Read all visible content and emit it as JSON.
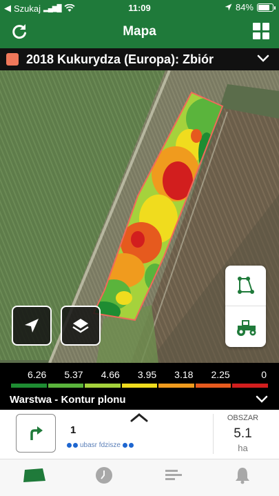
{
  "status_bar": {
    "back_app": "Szukaj",
    "time": "11:09",
    "battery": "84%",
    "battery_level": 0.84
  },
  "navbar": {
    "title": "Mapa",
    "refresh_icon": "refresh-icon",
    "menu_icon": "grid-menu-icon"
  },
  "field_header": {
    "name": "2018 Kukurydza (Europa): Zbiór",
    "swatch_color": "#f0785a"
  },
  "map_controls": {
    "locate_icon": "location-arrow-icon",
    "layers_icon": "layers-icon",
    "field_edit_icon": "field-boundary-icon",
    "tractor_icon": "tractor-icon"
  },
  "legend": {
    "values": [
      "6.26",
      "5.37",
      "4.66",
      "3.95",
      "3.18",
      "2.25",
      "0"
    ],
    "colors": [
      "#1e8c32",
      "#5ab43c",
      "#a5d23c",
      "#f0dc1e",
      "#f09b1e",
      "#e65a1e",
      "#d21e1e"
    ],
    "layer_label": "Warstwa - Kontur plonu"
  },
  "info_panel": {
    "count": "1",
    "area_label": "OBSZAR",
    "area_value": "5.1",
    "area_unit": "ha",
    "navigate_icon": "turn-right-arrow-icon"
  },
  "tab_bar": {
    "tabs": [
      "field-icon",
      "clock-icon",
      "list-icon",
      "bell-icon"
    ],
    "active_color": "#1f7a3a",
    "inactive_color": "#a8a8a8"
  }
}
